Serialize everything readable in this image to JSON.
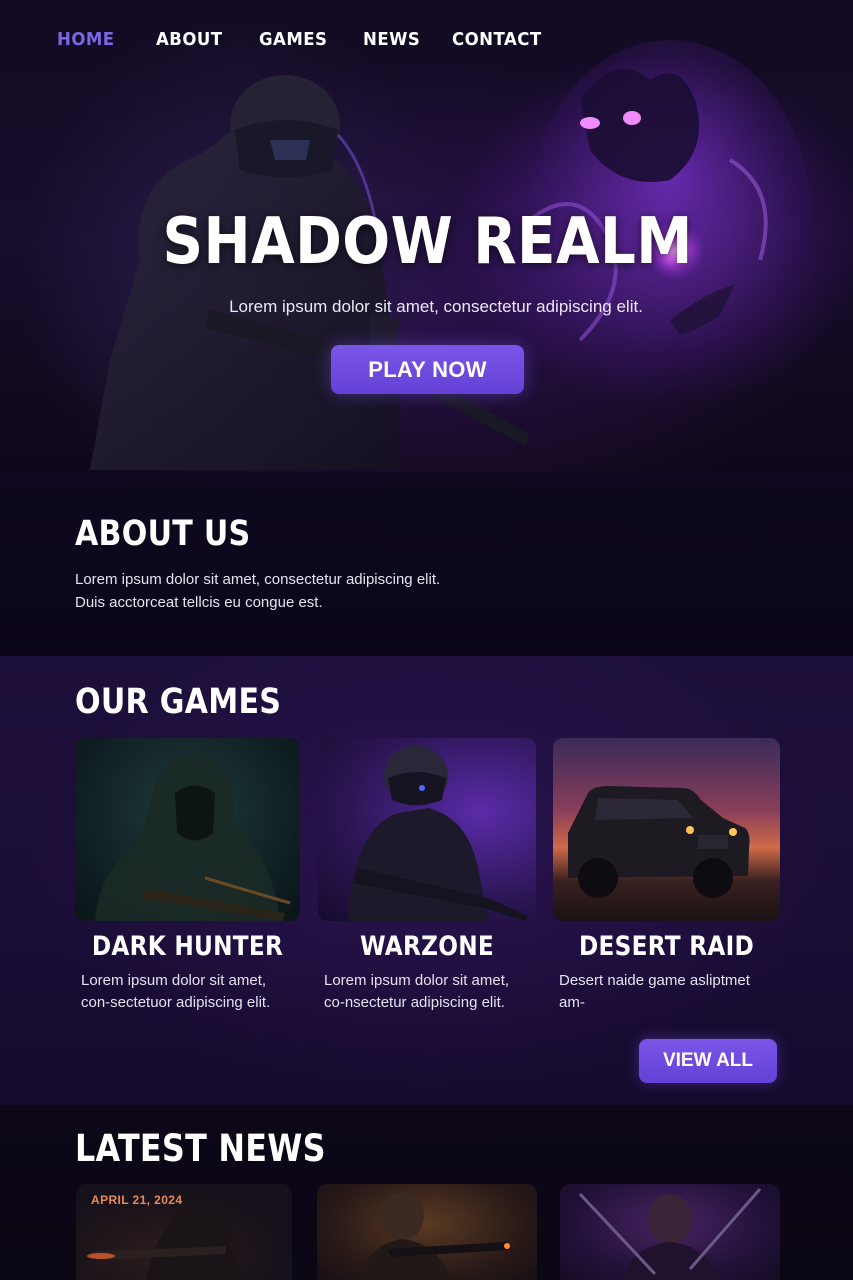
{
  "nav": {
    "items": [
      {
        "label": "HOME",
        "active": true
      },
      {
        "label": "ABOUT",
        "active": false
      },
      {
        "label": "GAMES",
        "active": false
      },
      {
        "label": "NEWS",
        "active": false
      },
      {
        "label": "CONTACT",
        "active": false
      }
    ]
  },
  "hero": {
    "title": "SHADOW REALM",
    "subtitle": "Lorem ipsum dolor sit amet, consectetur adipiscing elit.",
    "cta_label": "PLAY NOW"
  },
  "about": {
    "title": "ABOUT US",
    "line1": "Lorem ipsum dolor sit amet, consectetur adipiscing elit.",
    "line2": "Duis acctorceat tellcis eu congue est."
  },
  "games": {
    "title": "OUR GAMES",
    "items": [
      {
        "name": "DARK HUNTER",
        "description": "Lorem ipsum dolor sit amet, con-sectetuor adipiscing elit."
      },
      {
        "name": "WARZONE",
        "description": "Lorem ipsum dolor sit amet, co-nsectetur adipiscing elit."
      },
      {
        "name": "DESERT RAID",
        "description": "Desert naide game asliptmet am-"
      }
    ],
    "view_all_label": "VIEW ALL"
  },
  "news": {
    "title": "LATEST NEWS",
    "items": [
      {
        "date": "APRIL 21, 2024"
      },
      {
        "date": ""
      },
      {
        "date": ""
      }
    ]
  },
  "colors": {
    "accent": "#7b68e6",
    "button": "#6f4de0",
    "background": "#0c0718",
    "games_bg": "#1b0e38",
    "date": "#e7895a"
  },
  "icons": [
    "soldier-illustration",
    "shadow-creature-illustration",
    "hooded-hunter-thumbnail",
    "armored-soldier-thumbnail",
    "jeep-thumbnail"
  ]
}
